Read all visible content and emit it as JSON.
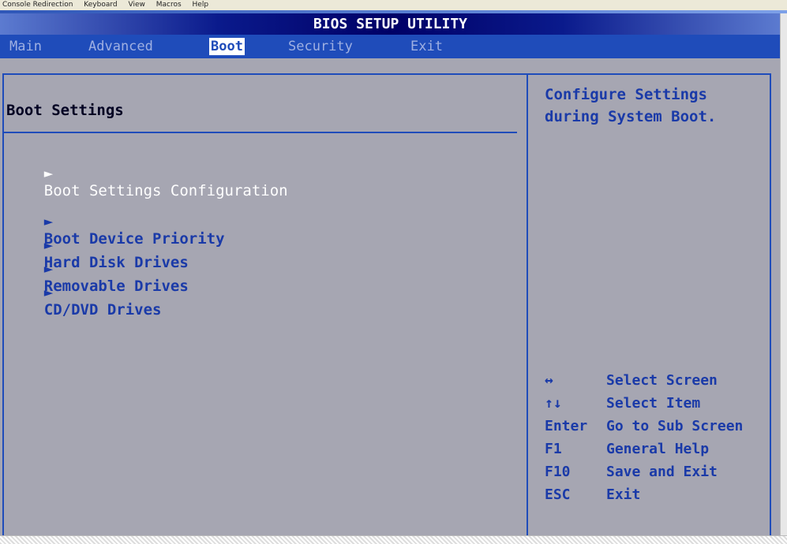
{
  "window_menu": [
    "Console Redirection",
    "Keyboard",
    "View",
    "Macros",
    "Help"
  ],
  "bios": {
    "title": "BIOS SETUP UTILITY",
    "tabs": [
      "Main",
      "Advanced",
      "Boot",
      "Security",
      "Exit"
    ],
    "active_tab": "Boot",
    "section_title": "Boot Settings",
    "items": [
      {
        "arrow": "►",
        "label": "Boot Settings Configuration"
      },
      {
        "arrow": "►",
        "label": "Boot Device Priority"
      },
      {
        "arrow": "►",
        "label": "Hard Disk Drives"
      },
      {
        "arrow": "►",
        "label": "Removable Drives"
      },
      {
        "arrow": "►",
        "label": "CD/DVD Drives"
      }
    ],
    "help_text": "Configure Settings during System Boot.",
    "key_legend": [
      {
        "key": "↔",
        "desc": "Select Screen"
      },
      {
        "key": "↑↓",
        "desc": "Select Item"
      },
      {
        "key": "Enter",
        "desc": "Go to Sub Screen"
      },
      {
        "key": "F1",
        "desc": "General Help"
      },
      {
        "key": "F10",
        "desc": "Save and Exit"
      },
      {
        "key": "ESC",
        "desc": "Exit"
      }
    ],
    "colors": {
      "background": "#a6a6b2",
      "tab_bar": "#1f4cba",
      "text_blue": "#1a3aa8",
      "title_dark": "#000066"
    }
  }
}
